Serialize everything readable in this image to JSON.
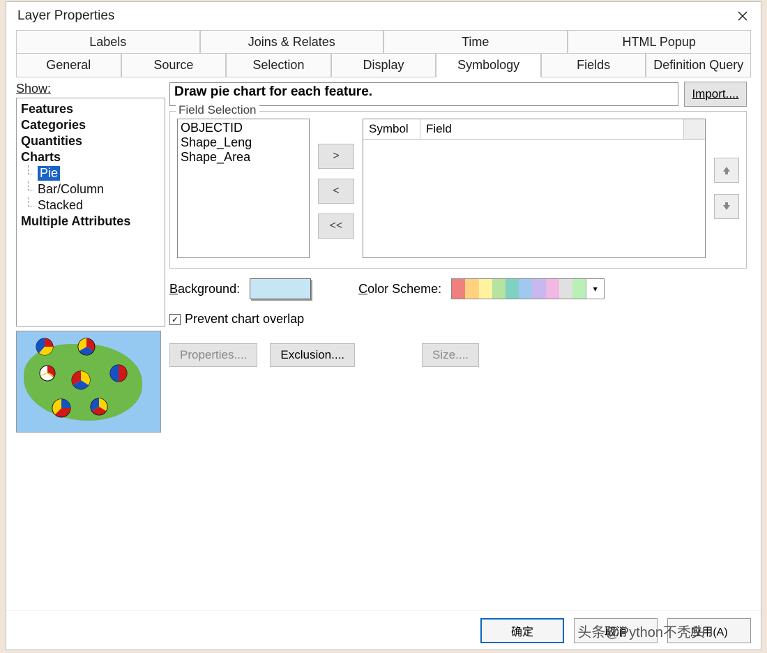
{
  "window": {
    "title": "Layer Properties"
  },
  "tabs_top": [
    "Labels",
    "Joins & Relates",
    "Time",
    "HTML Popup"
  ],
  "tabs_bottom": [
    "General",
    "Source",
    "Selection",
    "Display",
    "Symbology",
    "Fields",
    "Definition Query"
  ],
  "active_tab": "Symbology",
  "show": {
    "label": "Show:",
    "items": {
      "features": "Features",
      "categories": "Categories",
      "quantities": "Quantities",
      "charts": "Charts",
      "pie": "Pie",
      "barcolumn": "Bar/Column",
      "stacked": "Stacked",
      "multiple": "Multiple Attributes"
    },
    "selected": "Pie"
  },
  "description": "Draw pie chart for each feature.",
  "import_btn": "Import....",
  "field_selection": {
    "legend": "Field Selection",
    "available": [
      "OBJECTID",
      "Shape_Leng",
      "Shape_Area"
    ],
    "grid_headers": {
      "symbol": "Symbol",
      "field": "Field"
    },
    "move_right": ">",
    "move_left": "<",
    "move_all_left": "<<"
  },
  "background": {
    "label": "Background:",
    "color": "#c7e6f4"
  },
  "color_scheme": {
    "label": "Color Scheme:",
    "colors": [
      "#f08080",
      "#ffd27f",
      "#fff3a0",
      "#b7e3a0",
      "#7fd1c1",
      "#a0c8f0",
      "#c7b8f0",
      "#f0b8e3",
      "#e0e0e0",
      "#b8f0b8"
    ]
  },
  "prevent_overlap": {
    "label": "Prevent chart overlap",
    "checked": true
  },
  "buttons": {
    "properties": "Properties....",
    "exclusion": "Exclusion....",
    "size": "Size...."
  },
  "dialog": {
    "ok": "确定",
    "cancel": "取消",
    "apply": "应用(A)"
  },
  "watermark": "头条@Python不秃头"
}
